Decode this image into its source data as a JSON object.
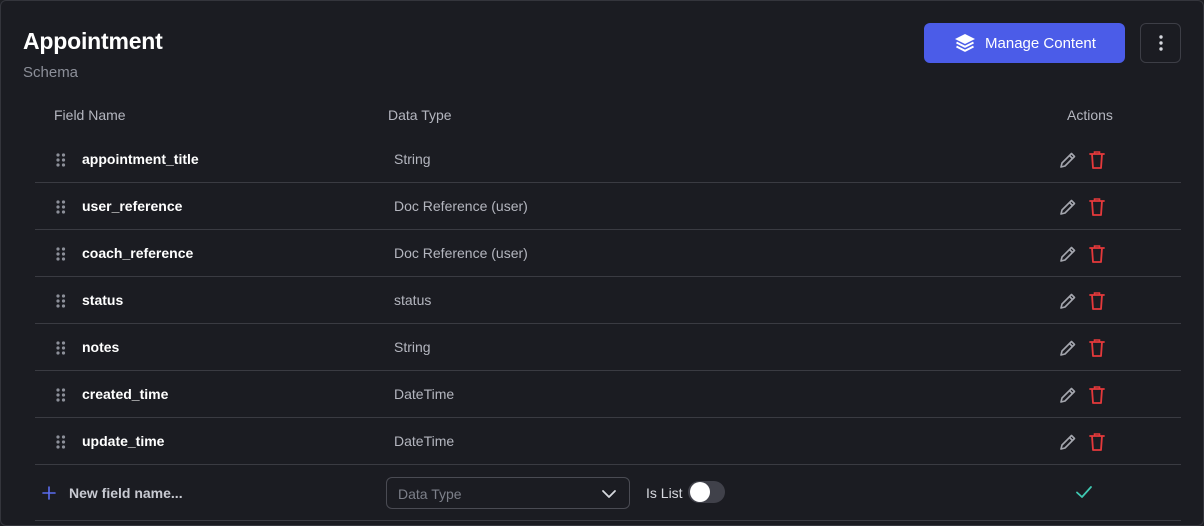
{
  "header": {
    "title": "Appointment",
    "subtitle": "Schema",
    "manage_button_label": "Manage Content",
    "manage_icon": "layers-icon",
    "more_icon": "more-vertical-icon"
  },
  "table": {
    "columns": {
      "field_name": "Field Name",
      "data_type": "Data Type",
      "actions": "Actions"
    },
    "rows": [
      {
        "name": "appointment_title",
        "type": "String"
      },
      {
        "name": "user_reference",
        "type": "Doc Reference (user)"
      },
      {
        "name": "coach_reference",
        "type": "Doc Reference (user)"
      },
      {
        "name": "status",
        "type": "status"
      },
      {
        "name": "notes",
        "type": "String"
      },
      {
        "name": "created_time",
        "type": "DateTime"
      },
      {
        "name": "update_time",
        "type": "DateTime"
      }
    ]
  },
  "new_field": {
    "name_value": "",
    "name_placeholder": "New field name...",
    "data_type_placeholder": "Data Type",
    "is_list_label": "Is List",
    "is_list_on": false
  },
  "colors": {
    "accent": "#4b5ce8",
    "delete": "#e5393b",
    "confirm": "#3fc9b2",
    "background": "#1b1c22"
  }
}
